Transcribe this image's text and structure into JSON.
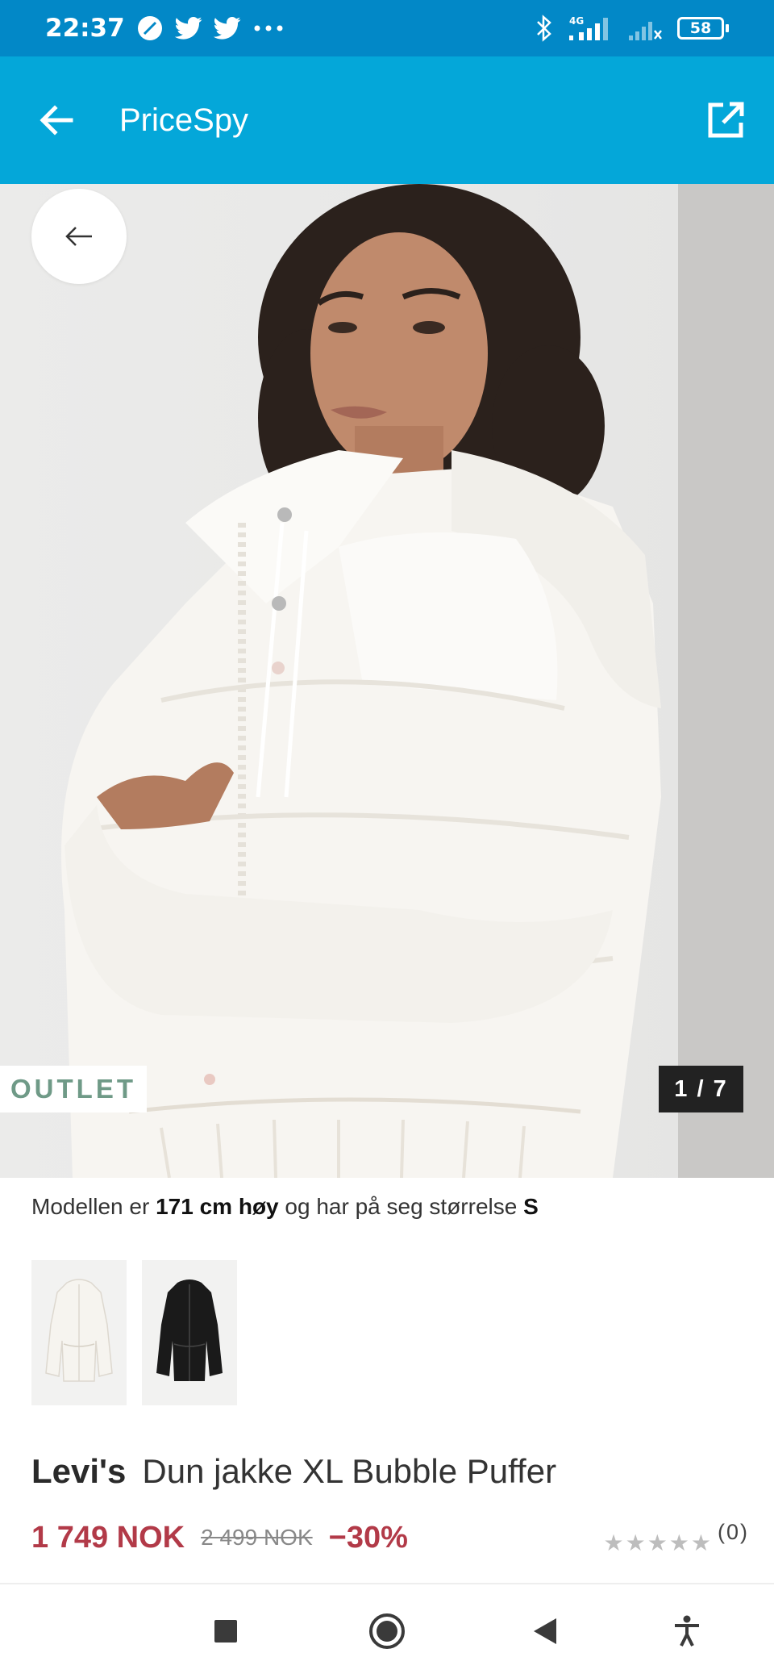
{
  "status_bar": {
    "time": "22:37",
    "battery_level": "58",
    "network_label": "4G",
    "icons": [
      "speed-icon",
      "twitter-icon",
      "twitter-icon",
      "more-icon",
      "bluetooth-icon",
      "signal-icon",
      "signal-off-icon",
      "battery-icon"
    ]
  },
  "app_bar": {
    "title": "PriceSpy",
    "back_icon": "arrow-left-icon",
    "open_icon": "open-external-icon"
  },
  "gallery": {
    "badge": "OUTLET",
    "counter": "1 / 7",
    "back_icon": "arrow-left-icon"
  },
  "model_info": {
    "prefix": "Modellen er ",
    "height": "171 cm høy",
    "middle": " og har på seg størrelse ",
    "size": "S"
  },
  "thumbnails": [
    {
      "color": "#f4f2ee",
      "label": "white-jacket"
    },
    {
      "color": "#1a1a1a",
      "label": "black-jacket"
    }
  ],
  "product": {
    "brand": "Levi's",
    "name": "Dun jakke XL Bubble Puffer",
    "price": "1 749 NOK",
    "old_price": "2 499 NOK",
    "discount": "−30%",
    "stars": "★★★★★",
    "rating_count": "(0)"
  },
  "colors": {
    "status_bar": "#0288c7",
    "app_bar": "#04a7d9",
    "price": "#b23a48",
    "outlet": "#6f9a87"
  },
  "nav": {
    "icons": [
      "recents-icon",
      "home-icon",
      "back-icon",
      "accessibility-icon"
    ]
  }
}
